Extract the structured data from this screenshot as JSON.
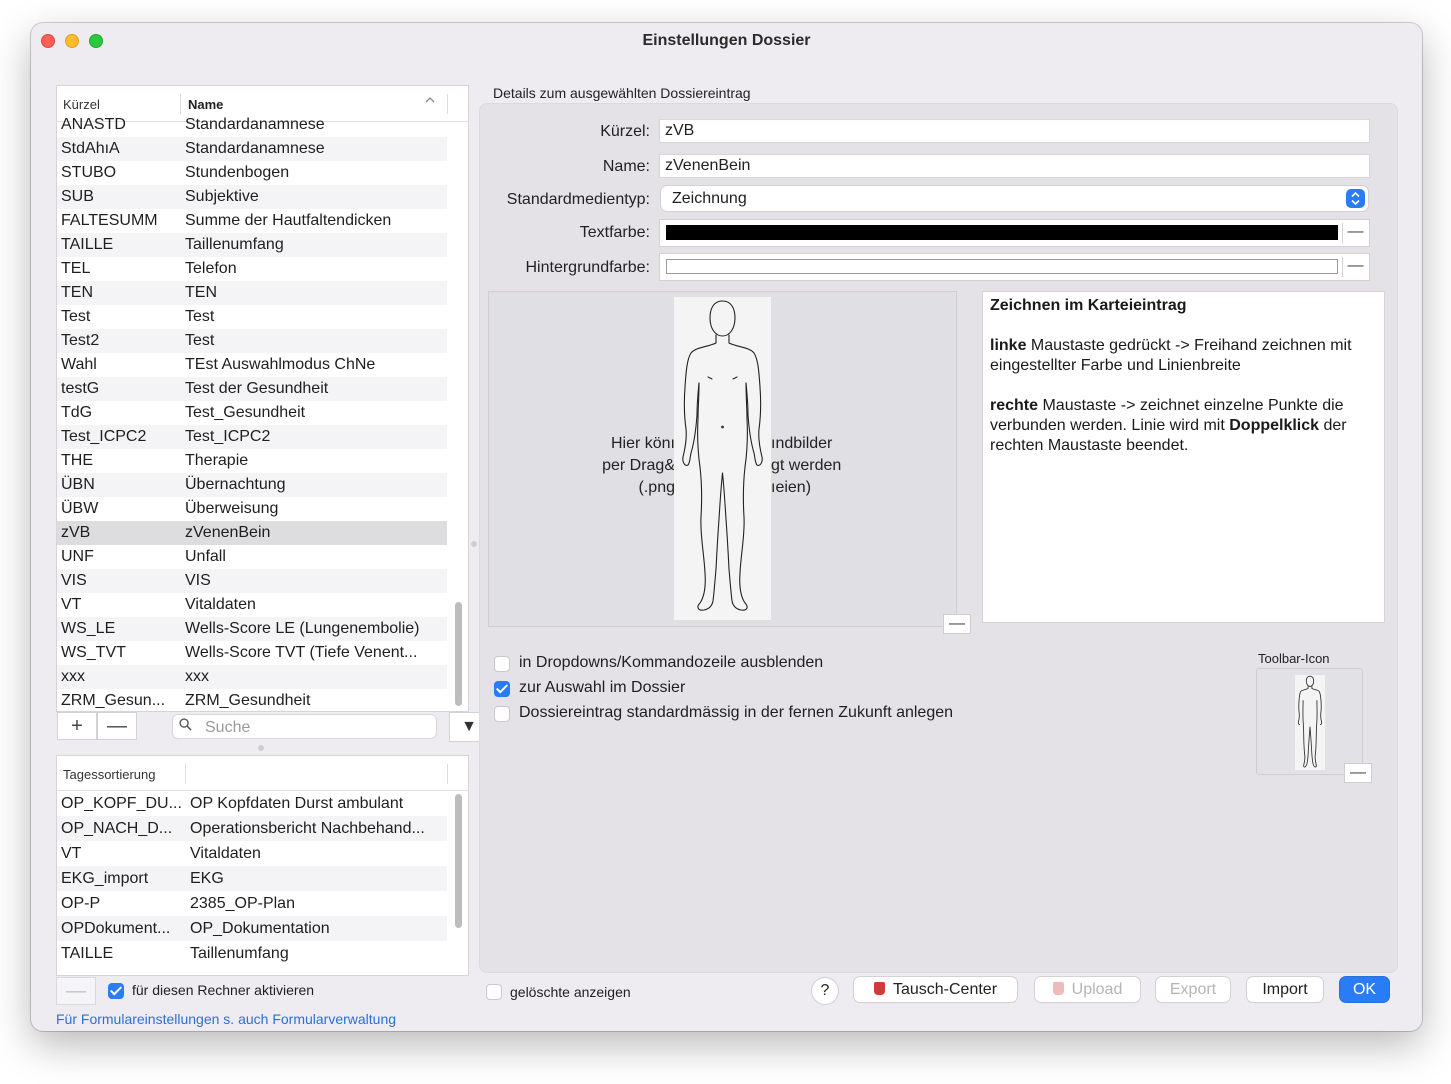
{
  "window": {
    "title": "Einstellungen Dossier"
  },
  "list": {
    "headers": {
      "kuerzel": "Kürzel",
      "name": "Name"
    },
    "rows": [
      {
        "k": "ANASTD",
        "n": "Standardanamnese"
      },
      {
        "k": "StdAhıA",
        "n": "Standardanamnese"
      },
      {
        "k": "STUBO",
        "n": "Stundenbogen"
      },
      {
        "k": "SUB",
        "n": "Subjektive"
      },
      {
        "k": "FALTESUMM",
        "n": "Summe der Hautfaltendicken"
      },
      {
        "k": "TAILLE",
        "n": "Taillenumfang"
      },
      {
        "k": "TEL",
        "n": "Telefon"
      },
      {
        "k": "TEN",
        "n": "TEN"
      },
      {
        "k": "Test",
        "n": "Test"
      },
      {
        "k": "Test2",
        "n": "Test"
      },
      {
        "k": "Wahl",
        "n": "TEst Auswahlmodus ChNe"
      },
      {
        "k": "testG",
        "n": "Test der Gesundheit"
      },
      {
        "k": "TdG",
        "n": "Test_Gesundheit"
      },
      {
        "k": "Test_ICPC2",
        "n": "Test_ICPC2"
      },
      {
        "k": "THE",
        "n": "Therapie"
      },
      {
        "k": "ÜBN",
        "n": "Übernachtung"
      },
      {
        "k": "ÜBW",
        "n": "Überweisung"
      },
      {
        "k": "zVB",
        "n": "zVenenBein"
      },
      {
        "k": "UNF",
        "n": "Unfall"
      },
      {
        "k": "VIS",
        "n": "VIS"
      },
      {
        "k": "VT",
        "n": "Vitaldaten"
      },
      {
        "k": "WS_LE",
        "n": "Wells-Score LE (Lungenembolie)"
      },
      {
        "k": "WS_TVT",
        "n": "Wells-Score TVT (Tiefe Venent..."
      },
      {
        "k": "xxx",
        "n": "xxx"
      },
      {
        "k": "ZRM_Gesun...",
        "n": "ZRM_Gesundheit"
      }
    ],
    "selected": "zVB",
    "add_label": "+",
    "remove_label": "—",
    "search_placeholder": "Suche",
    "dropdown_label": "▼"
  },
  "day_sort": {
    "header": "Tagessortierung",
    "rows": [
      {
        "k": "OP_KOPF_DU...",
        "n": "OP Kopfdaten Durst ambulant"
      },
      {
        "k": "OP_NACH_D...",
        "n": "Operationsbericht Nachbehand..."
      },
      {
        "k": "VT",
        "n": "Vitaldaten"
      },
      {
        "k": "EKG_import",
        "n": "EKG"
      },
      {
        "k": "OP-P",
        "n": "2385_OP-Plan"
      },
      {
        "k": "OPDokument...",
        "n": "OP_Dokumentation"
      },
      {
        "k": "TAILLE",
        "n": "Taillenumfang"
      }
    ],
    "remove_label": "—",
    "activate_label": "für diesen Rechner aktivieren",
    "activate_checked": true
  },
  "link_text": "Für Formulareinstellungen s. auch Formularverwaltung",
  "details": {
    "group_title": "Details zum ausgewählten Dossiereintrag",
    "kuerzel_label": "Kürzel:",
    "kuerzel_value": "zVB",
    "name_label": "Name:",
    "name_value": "zVenenBein",
    "medientyp_label": "Standardmedientyp:",
    "medientyp_value": "Zeichnung",
    "textfarbe_label": "Textfarbe:",
    "textfarbe_color": "#000000",
    "hintergrund_label": "Hintergrundfarbe:",
    "hintergrund_color": "#ffffff",
    "color_remove_label": "—",
    "drop_line1_a": "Hier könı",
    "drop_line1_b": "ındbilder",
    "drop_line2_a": "per Drag&",
    "drop_line2_b": "gt werden",
    "drop_line3_a": "(.png",
    "drop_line3_b": "ıeien)",
    "drawing_remove_label": "—",
    "info_title": "Zeichnen im Karteieintrag",
    "info_p1_bold": "linke",
    "info_p1_rest": " Maustaste gedrückt -> Freihand zeichnen mit eingestellter Farbe und Linienbreite",
    "info_p2_bold": "rechte",
    "info_p2_rest": " Maustaste -> zeichnet einzelne Punkte die verbunden werden. Linie wird mit ",
    "info_p2_bold2": "Doppelklick",
    "info_p2_rest2": " der rechten Maustaste beendet.",
    "cb1_label": "in Dropdowns/Kommandozeile ausblenden",
    "cb1_checked": false,
    "cb2_label": "zur Auswahl im Dossier",
    "cb2_checked": true,
    "cb3_label": "Dossiereintrag standardmässig in der fernen Zukunft anlegen",
    "cb3_checked": false,
    "toolbar_icon_label": "Toolbar-Icon",
    "toolbar_icon_remove_label": "—"
  },
  "footer": {
    "deleted_label": "gelöschte anzeigen",
    "deleted_checked": false,
    "help_label": "?",
    "tausch_label": "Tausch-Center",
    "upload_label": "Upload",
    "export_label": "Export",
    "import_label": "Import",
    "ok_label": "OK",
    "accent_color": "#2a7cf6",
    "bag_color": "#d23a3a"
  }
}
